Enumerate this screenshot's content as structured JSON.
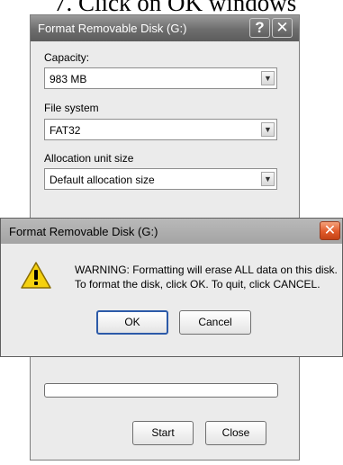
{
  "caption": "7. Click on OK windows",
  "format_window": {
    "title": "Format Removable Disk (G:)",
    "help_glyph": "?",
    "close_glyph": "✕",
    "capacity_label": "Capacity:",
    "capacity_value": "983 MB",
    "filesystem_label": "File system",
    "filesystem_value": "FAT32",
    "allocation_label": "Allocation unit size",
    "allocation_value": "Default allocation size",
    "dropdown_glyph": "▼",
    "format_progress": 0,
    "start_label": "Start",
    "close_label": "Close"
  },
  "warning_dialog": {
    "title": "Format Removable Disk (G:)",
    "close_glyph": "✕",
    "icon": "warning-icon",
    "message_line1": "WARNING: Formatting will erase ALL data on this disk.",
    "message_line2": "To format the disk, click OK. To quit, click CANCEL.",
    "ok_label": "OK",
    "cancel_label": "Cancel"
  },
  "colors": {
    "warning_yellow": "#f5d10f",
    "close_red": "#e05a2a",
    "default_button_border": "#2c5aa8"
  }
}
